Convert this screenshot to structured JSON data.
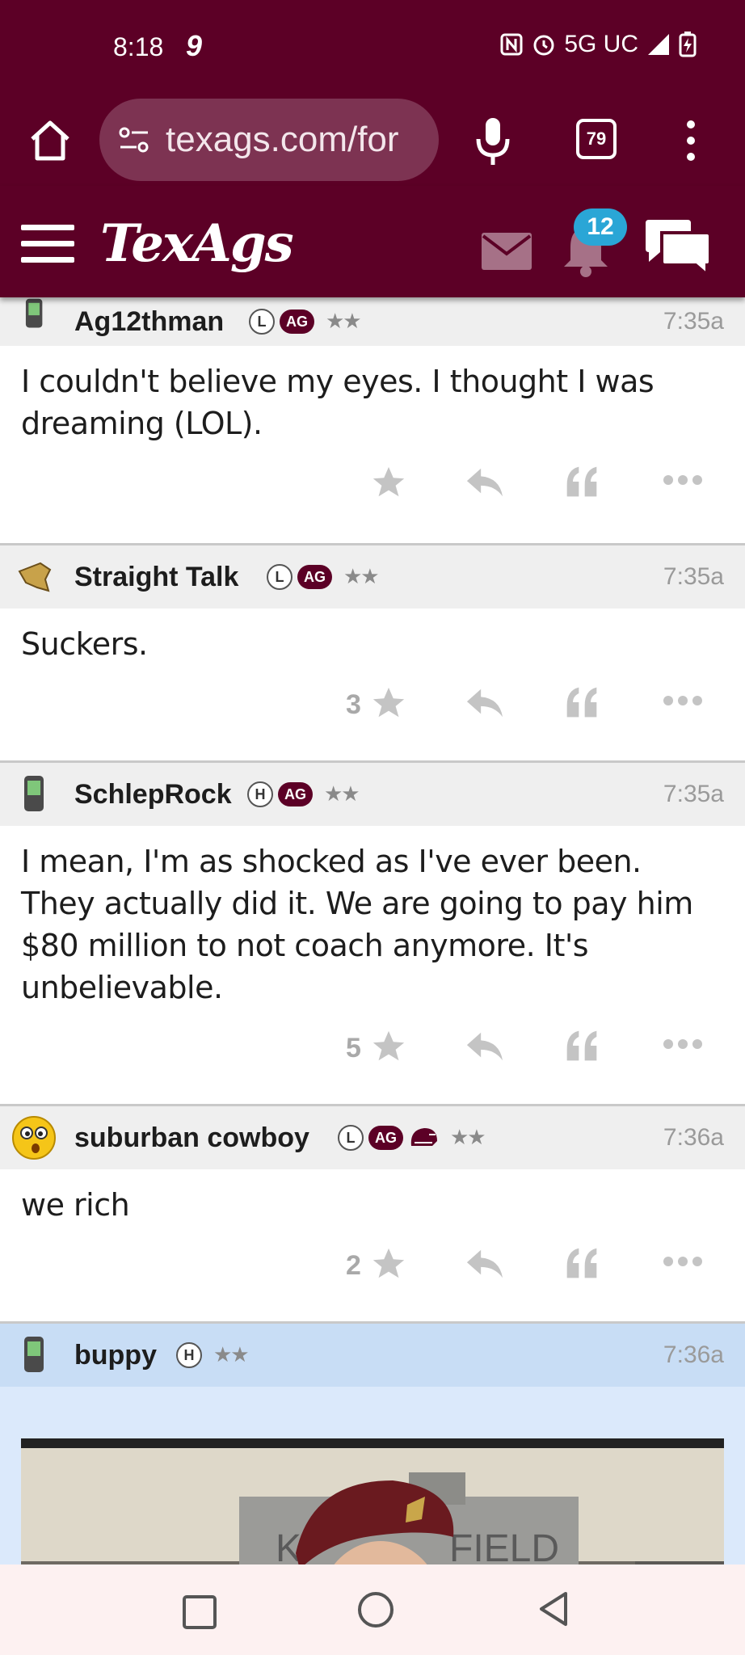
{
  "status_bar": {
    "time": "8:18",
    "carrier_glyph": "9",
    "network": "5G UC",
    "icons": [
      "nfc-icon",
      "alarm-icon",
      "signal-icon",
      "battery-charging-icon"
    ]
  },
  "browser": {
    "url": "texags.com/for",
    "tab_count": "79",
    "icons": [
      "home-icon",
      "site-settings-icon",
      "mic-icon",
      "tabs-icon",
      "more-icon"
    ]
  },
  "site_header": {
    "logo": "TexAgs",
    "notification_count": "12",
    "icons": [
      "hamburger-icon",
      "mail-icon",
      "bell-icon",
      "chat-icon"
    ]
  },
  "posts": [
    {
      "username": "Ag12thman",
      "badge_letter": "L",
      "badge_ag": "AG",
      "stars": "★★",
      "time": "7:35a",
      "body": "I couldn't believe my eyes. I thought I was dreaming (LOL).",
      "star_count": ""
    },
    {
      "username": "Straight Talk",
      "badge_letter": "L",
      "badge_ag": "AG",
      "stars": "★★",
      "time": "7:35a",
      "body": "Suckers.",
      "star_count": "3"
    },
    {
      "username": "SchlepRock",
      "badge_letter": "H",
      "badge_ag": "AG",
      "stars": "★★",
      "time": "7:35a",
      "body": "I mean, I'm as shocked as I've ever been. They actually did it. We are going to pay him $80 million to not coach anymore. It's unbelievable.",
      "star_count": "5"
    },
    {
      "username": "suburban cowboy",
      "badge_letter": "L",
      "badge_ag": "AG",
      "stars": "★★",
      "time": "7:36a",
      "body": "we rich",
      "star_count": "2"
    },
    {
      "username": "buppy",
      "badge_letter": "H",
      "stars": "★★",
      "time": "7:36a",
      "image_text_left": "K",
      "image_text_right": "FIELD"
    }
  ],
  "colors": {
    "maroon": "#5c0026",
    "url_pill": "#7d3352",
    "badge_blue": "#2aa6d6",
    "highlight_post": "#dbe9fb"
  }
}
